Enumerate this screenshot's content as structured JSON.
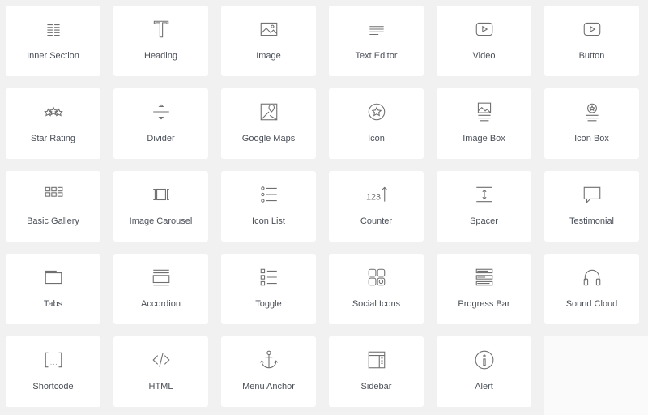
{
  "widgets": [
    {
      "label": "Inner Section",
      "icon": "inner-section-icon"
    },
    {
      "label": "Heading",
      "icon": "heading-icon"
    },
    {
      "label": "Image",
      "icon": "image-icon"
    },
    {
      "label": "Text Editor",
      "icon": "text-editor-icon"
    },
    {
      "label": "Video",
      "icon": "video-icon"
    },
    {
      "label": "Button",
      "icon": "button-icon"
    },
    {
      "label": "Star Rating",
      "icon": "star-rating-icon"
    },
    {
      "label": "Divider",
      "icon": "divider-icon"
    },
    {
      "label": "Google Maps",
      "icon": "google-maps-icon"
    },
    {
      "label": "Icon",
      "icon": "star-circle-icon"
    },
    {
      "label": "Image Box",
      "icon": "image-box-icon"
    },
    {
      "label": "Icon Box",
      "icon": "icon-box-icon"
    },
    {
      "label": "Basic Gallery",
      "icon": "gallery-icon"
    },
    {
      "label": "Image Carousel",
      "icon": "carousel-icon"
    },
    {
      "label": "Icon List",
      "icon": "icon-list-icon"
    },
    {
      "label": "Counter",
      "icon": "counter-icon"
    },
    {
      "label": "Spacer",
      "icon": "spacer-icon"
    },
    {
      "label": "Testimonial",
      "icon": "testimonial-icon"
    },
    {
      "label": "Tabs",
      "icon": "tabs-icon"
    },
    {
      "label": "Accordion",
      "icon": "accordion-icon"
    },
    {
      "label": "Toggle",
      "icon": "toggle-icon"
    },
    {
      "label": "Social Icons",
      "icon": "social-icons-icon"
    },
    {
      "label": "Progress Bar",
      "icon": "progress-bar-icon"
    },
    {
      "label": "Sound Cloud",
      "icon": "headphones-icon"
    },
    {
      "label": "Shortcode",
      "icon": "shortcode-icon"
    },
    {
      "label": "HTML",
      "icon": "code-icon"
    },
    {
      "label": "Menu Anchor",
      "icon": "anchor-icon"
    },
    {
      "label": "Sidebar",
      "icon": "sidebar-icon"
    },
    {
      "label": "Alert",
      "icon": "info-icon"
    }
  ]
}
